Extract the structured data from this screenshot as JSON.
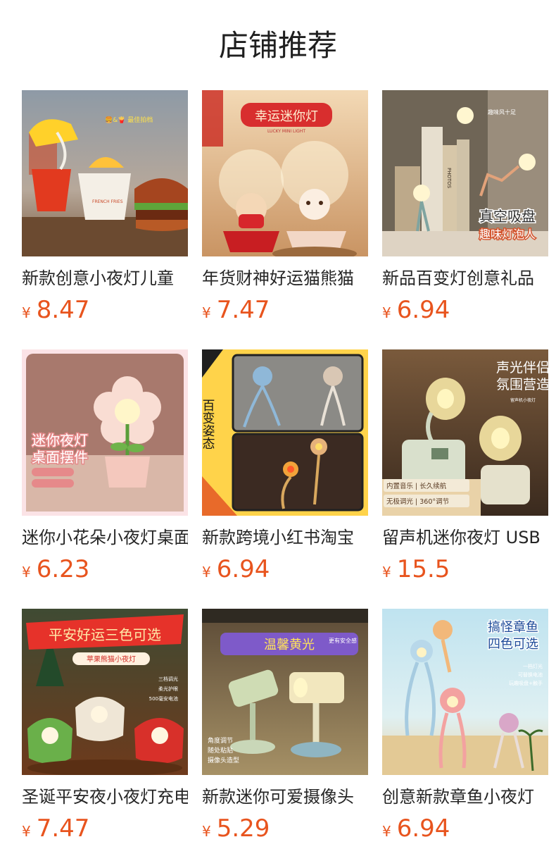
{
  "page": {
    "title": "店铺推荐"
  },
  "products": [
    {
      "name": "新款创意小夜灯儿童",
      "currency": "¥",
      "price": "8.47",
      "image_text": [
        "🍔&🍟 最佳拍档",
        "FRENCH FRIES"
      ]
    },
    {
      "name": "年货财神好运猫熊猫",
      "currency": "¥",
      "price": "7.47",
      "image_text": [
        "幸运迷你灯",
        "LUCKY MINI LIGHT"
      ]
    },
    {
      "name": "新品百变灯创意礼品",
      "currency": "¥",
      "price": "6.94",
      "image_text": [
        "趣味风十足",
        "真空吸盘",
        "趣味灯泡人",
        "PHOTOS"
      ]
    },
    {
      "name": "迷你小花朵小夜灯桌面",
      "currency": "¥",
      "price": "6.23",
      "image_text": [
        "迷你夜灯",
        "桌面摆件"
      ]
    },
    {
      "name": "新款跨境小红书淘宝",
      "currency": "¥",
      "price": "6.94",
      "image_text": [
        "百变姿态"
      ]
    },
    {
      "name": "留声机迷你夜灯 USB",
      "currency": "¥",
      "price": "15.5",
      "image_text": [
        "声光伴侣",
        "氛围营造",
        "留声机小夜灯",
        "内置音乐 | 长久续航",
        "无极调光 | 360°调节"
      ]
    },
    {
      "name": "圣诞平安夜小夜灯充电",
      "currency": "¥",
      "price": "7.47",
      "image_text": [
        "平安好运三色可选",
        "苹果熊猫小夜灯",
        "三档调光",
        "柔光护眼",
        "500毫安电池"
      ]
    },
    {
      "name": "新款迷你可爱摄像头",
      "currency": "¥",
      "price": "5.29",
      "image_text": [
        "温馨黄光",
        "更有安全感",
        "角度调节",
        "随处粘贴",
        "摄像头造型"
      ]
    },
    {
      "name": "创意新款章鱼小夜灯",
      "currency": "¥",
      "price": "6.94",
      "image_text": [
        "搞怪章鱼",
        "四色可选",
        "一档灯光",
        "可替换电池",
        "玩趣吸盘+触手"
      ]
    }
  ],
  "colors": {
    "price": "#e8541e",
    "title": "#1f1f1f",
    "name": "#262626"
  }
}
